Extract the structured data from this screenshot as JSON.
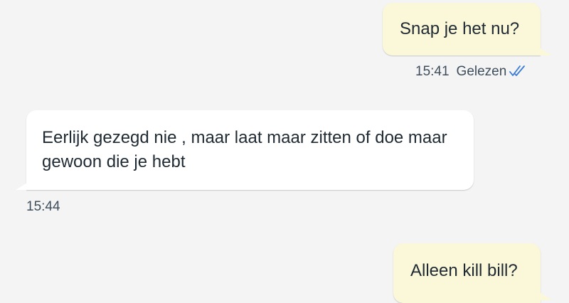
{
  "messages": [
    {
      "direction": "outgoing",
      "text": "Snap je het nu?",
      "time": "15:41",
      "status": "Gelezen",
      "status_icon": "double-check-icon"
    },
    {
      "direction": "incoming",
      "text": "Eerlijk gezegd nie , maar laat maar zitten of doe maar gewoon die je hebt",
      "time": "15:44"
    },
    {
      "direction": "outgoing",
      "text": "Alleen kill bill?"
    }
  ],
  "colors": {
    "background": "#f4f4f4",
    "outgoing_bubble": "#fbf7d9",
    "incoming_bubble": "#ffffff",
    "read_check": "#3a7bd5",
    "meta_text": "#3f4e5c"
  }
}
